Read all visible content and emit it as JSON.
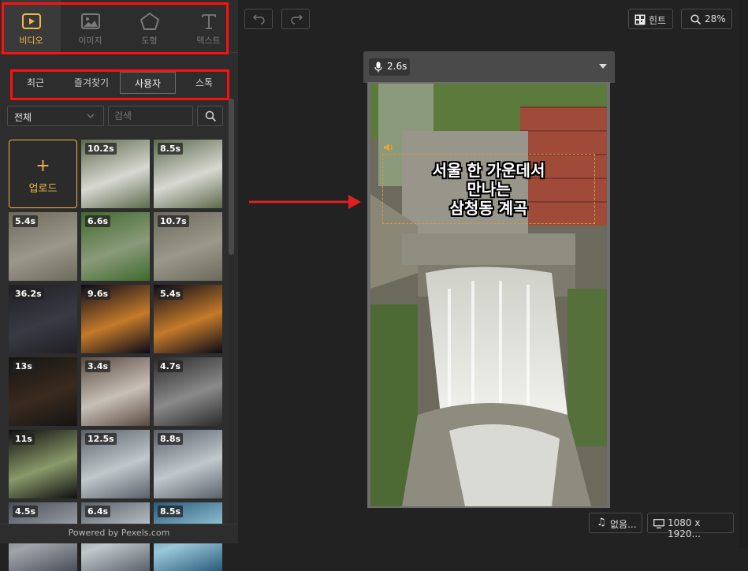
{
  "media_tabs": [
    {
      "label": "비디오",
      "icon": "video-icon"
    },
    {
      "label": "이미지",
      "icon": "image-icon"
    },
    {
      "label": "도형",
      "icon": "pentagon-icon"
    },
    {
      "label": "텍스트",
      "icon": "text-icon"
    }
  ],
  "sub_tabs": [
    "최근",
    "즐겨찾기",
    "사용자",
    "스톡"
  ],
  "filter": {
    "selected": "전체",
    "search_placeholder": "검색"
  },
  "upload_label": "업로드",
  "thumbnails": [
    {
      "duration": "10.2s",
      "theme": "waterfall"
    },
    {
      "duration": "8.5s",
      "theme": "waterfall"
    },
    {
      "duration": "5.4s",
      "theme": "stone"
    },
    {
      "duration": "6.6s",
      "theme": "green"
    },
    {
      "duration": "10.7s",
      "theme": "stone"
    },
    {
      "duration": "36.2s",
      "theme": "doc"
    },
    {
      "duration": "9.6s",
      "theme": "stage"
    },
    {
      "duration": "5.4s",
      "theme": "stage"
    },
    {
      "duration": "13s",
      "theme": "dark"
    },
    {
      "duration": "3.4s",
      "theme": "room"
    },
    {
      "duration": "4.7s",
      "theme": "people"
    },
    {
      "duration": "11s",
      "theme": "tree"
    },
    {
      "duration": "12.5s",
      "theme": "sea"
    },
    {
      "duration": "8.8s",
      "theme": "sea"
    },
    {
      "duration": "4.5s",
      "theme": "building"
    },
    {
      "duration": "6.4s",
      "theme": "sea"
    },
    {
      "duration": "8.5s",
      "theme": "water"
    }
  ],
  "powered_by": "Powered by Pexels.com",
  "toolbar": {
    "hint_label": "힌트",
    "zoom_label": "28%"
  },
  "preview": {
    "clip_duration": "2.6s",
    "subtitle_lines": [
      "서울 한 가운데서",
      "만나는",
      "삼청동 계곡"
    ]
  },
  "bottom": {
    "audio_label": "없음...",
    "resolution_label": "1080 x 1920..."
  },
  "colors": {
    "accent": "#f4b74a",
    "highlight": "#ff1010",
    "arrow": "#e02020"
  }
}
